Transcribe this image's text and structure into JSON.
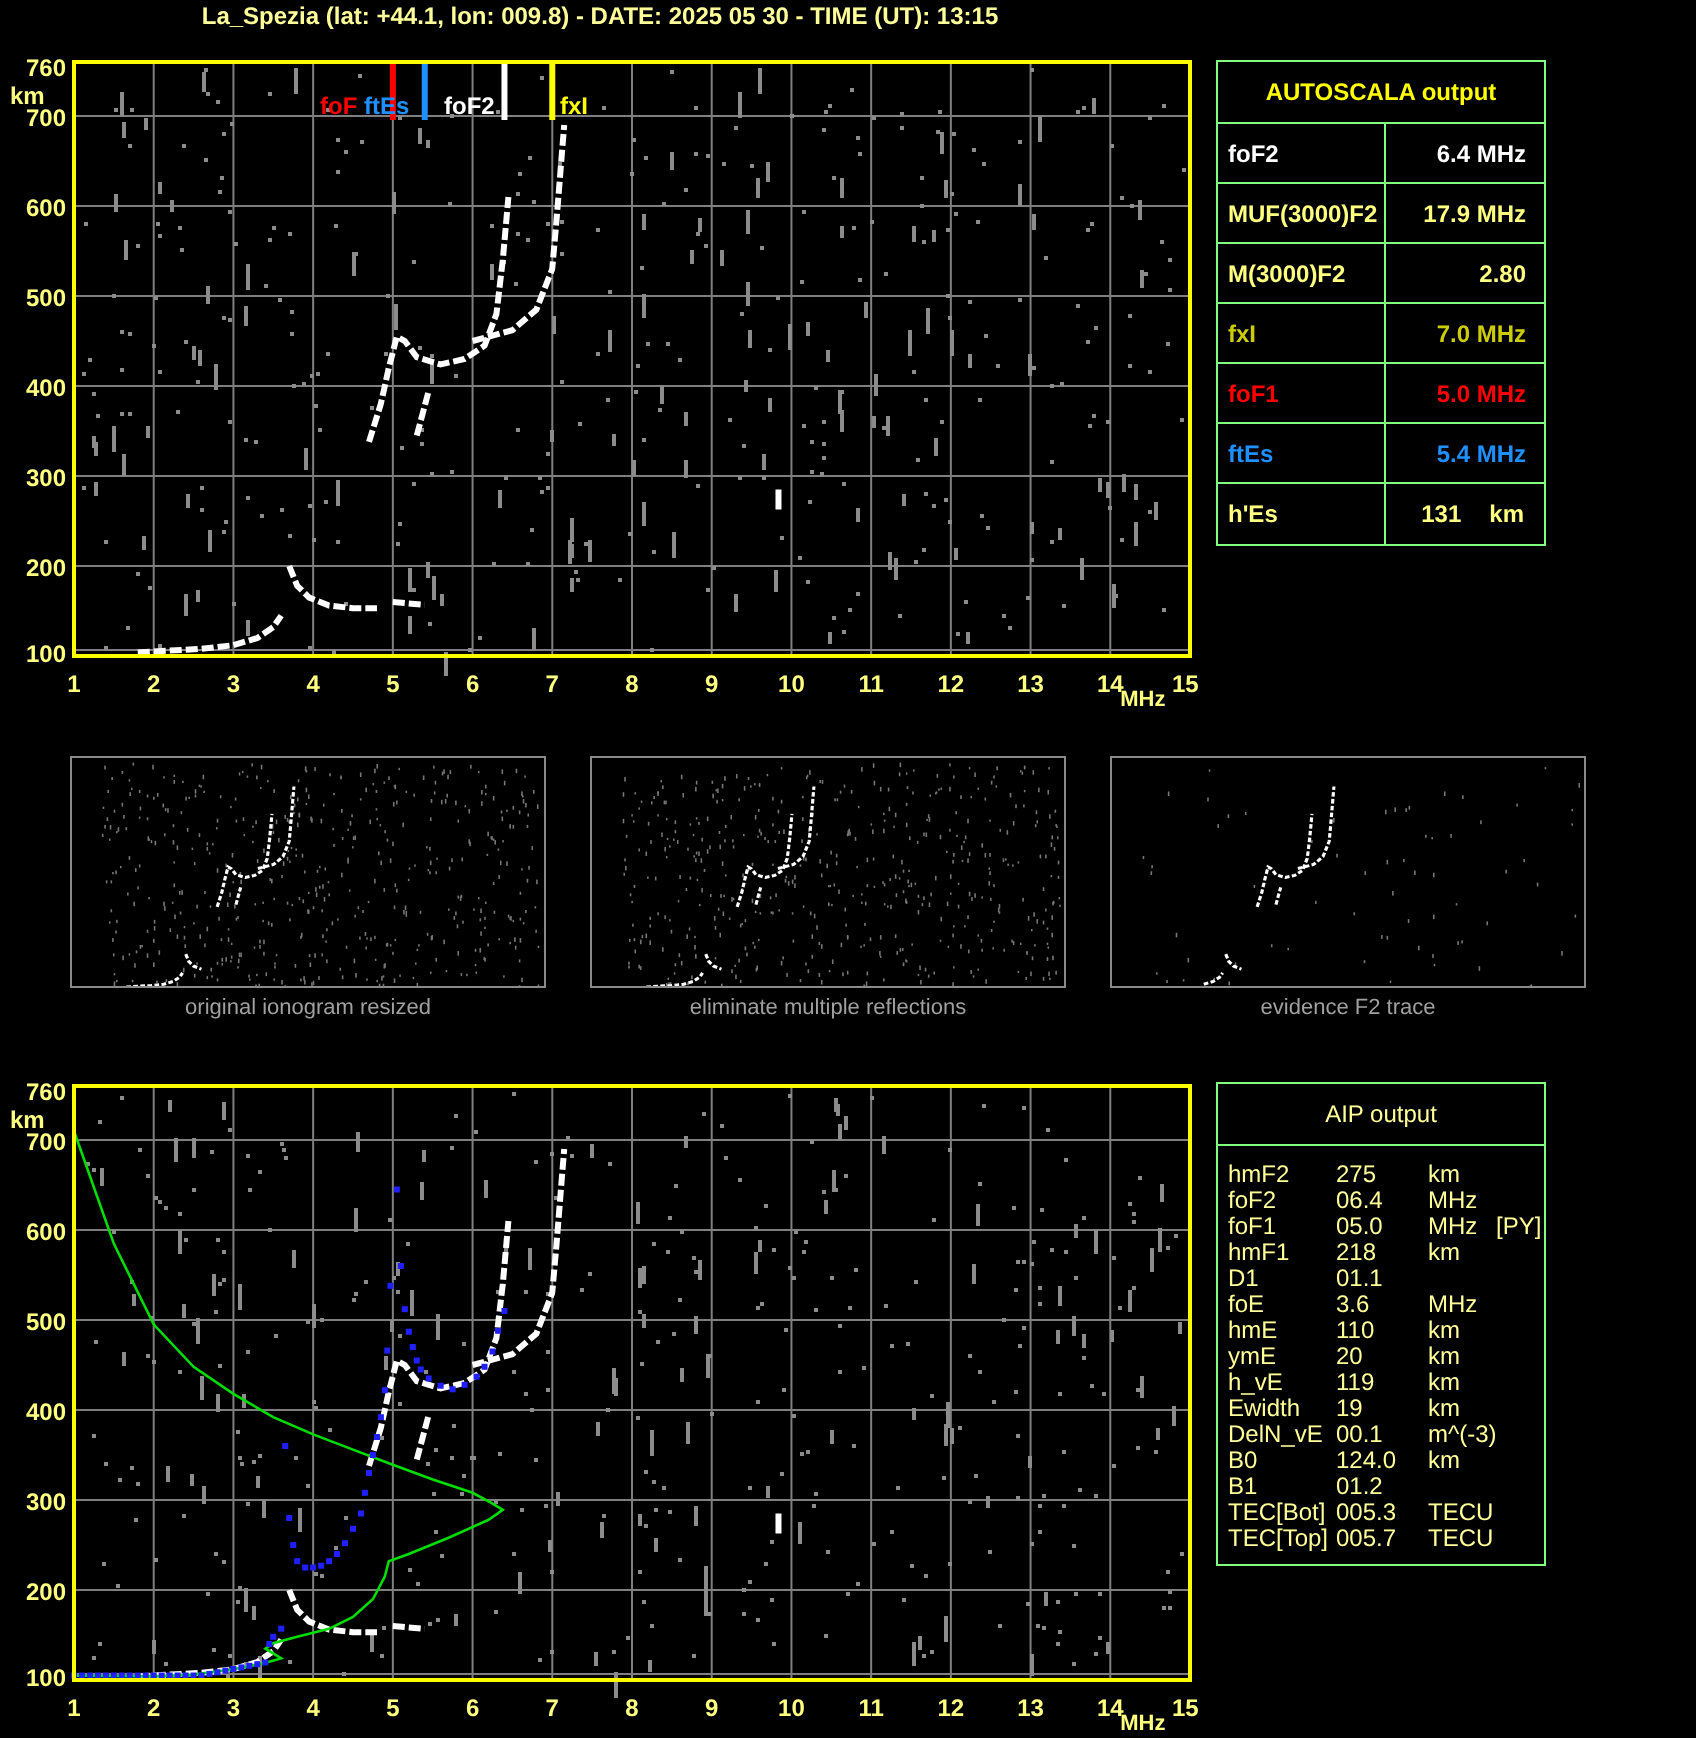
{
  "title": "La_Spezia (lat: +44.1, lon: 009.8) - DATE: 2025 05 30 - TIME (UT): 13:15",
  "ionogram": {
    "y_unit": "km",
    "x_unit": "MHz",
    "y_ticks": [
      "760",
      "700",
      "600",
      "500",
      "400",
      "300",
      "200",
      "100"
    ],
    "x_ticks": [
      "1",
      "2",
      "3",
      "4",
      "5",
      "6",
      "7",
      "8",
      "9",
      "10",
      "11",
      "12",
      "13",
      "14",
      "15"
    ],
    "markers": [
      {
        "label": "foF",
        "color": "#ff0000"
      },
      {
        "label": "ftEs",
        "color": "#1e90ff"
      },
      {
        "label": "foF2",
        "color": "#ffffff"
      },
      {
        "label": "fxI",
        "color": "#ffff00"
      }
    ]
  },
  "autoscala": {
    "title": "AUTOSCALA output",
    "rows": [
      {
        "label": "foF2",
        "value": "6.4 MHz",
        "color": "#ffffff"
      },
      {
        "label": "MUF(3000)F2",
        "value": "17.9 MHz",
        "color": "#ffff80"
      },
      {
        "label": "M(3000)F2",
        "value": "2.80",
        "color": "#ffff80"
      },
      {
        "label": "fxI",
        "value": "7.0 MHz",
        "color": "#cccc00"
      },
      {
        "label": "foF1",
        "value": "5.0 MHz",
        "color": "#ff0000"
      },
      {
        "label": "ftEs",
        "value": "5.4 MHz",
        "color": "#1e90ff"
      },
      {
        "label": "h'Es",
        "value": "131",
        "unit": "km",
        "color": "#ffff80"
      }
    ]
  },
  "thumbnails": [
    {
      "caption": "original ionogram resized"
    },
    {
      "caption": "eliminate multiple reflections"
    },
    {
      "caption": "evidence F2 trace"
    }
  ],
  "aip_ionogram": {
    "y_unit": "km",
    "x_unit": "MHz",
    "y_ticks": [
      "760",
      "700",
      "600",
      "500",
      "400",
      "300",
      "200",
      "100"
    ],
    "x_ticks": [
      "1",
      "2",
      "3",
      "4",
      "5",
      "6",
      "7",
      "8",
      "9",
      "10",
      "11",
      "12",
      "13",
      "14",
      "15"
    ]
  },
  "aip": {
    "title": "AIP output",
    "rows": [
      {
        "label": "hmF2",
        "value": "275",
        "unit": "km"
      },
      {
        "label": "foF2",
        "value": "06.4",
        "unit": "MHz"
      },
      {
        "label": "foF1",
        "value": "05.0",
        "unit": "MHz",
        "note": "[PY]"
      },
      {
        "label": "hmF1",
        "value": "218",
        "unit": "km"
      },
      {
        "label": "D1",
        "value": "01.1"
      },
      {
        "label": "foE",
        "value": "3.6",
        "unit": "MHz"
      },
      {
        "label": "hmE",
        "value": "110",
        "unit": "km"
      },
      {
        "label": "ymE",
        "value": "20",
        "unit": "km"
      },
      {
        "label": "h_vE",
        "value": "119",
        "unit": "km"
      },
      {
        "label": "Ewidth",
        "value": "19",
        "unit": "km"
      },
      {
        "label": "DelN_vE",
        "value": "00.1",
        "unit": "m^(-3)"
      },
      {
        "label": "B0",
        "value": "124.0",
        "unit": "km"
      },
      {
        "label": "B1",
        "value": "01.2"
      },
      {
        "label": "TEC[Bot]",
        "value": "005.3",
        "unit": "TECU"
      },
      {
        "label": "TEC[Top]",
        "value": "005.7",
        "unit": "TECU"
      }
    ]
  }
}
